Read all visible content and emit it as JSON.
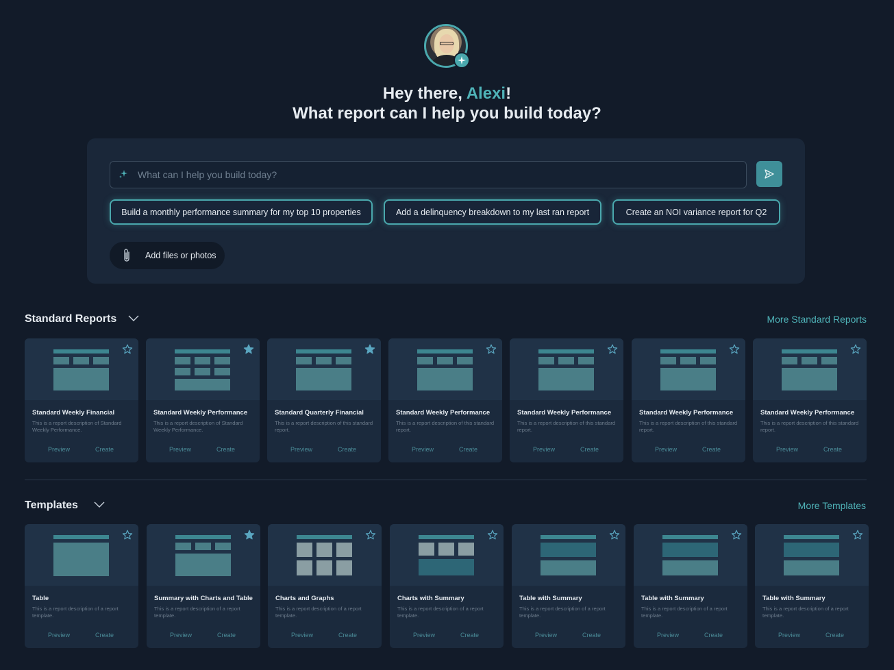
{
  "hero": {
    "greeting_prefix": "Hey there, ",
    "user_name": "Alexi",
    "greeting_suffix": "!",
    "question": "What report can I help you build today?"
  },
  "prompt": {
    "placeholder": "What can I help you build today?",
    "suggestions": [
      "Build a monthly performance summary for my top 10 properties",
      "Add a delinquency breakdown to my last ran report",
      "Create an NOI variance report for Q2"
    ],
    "attach_label": "Add files or photos"
  },
  "standard_reports": {
    "title": "Standard Reports",
    "more_link": "More Standard Reports",
    "cards": [
      {
        "title": "Standard Weekly Financial",
        "desc": "This is a report description of Standard Weekly Performance.",
        "starred": false,
        "layout": "table-3col"
      },
      {
        "title": "Standard Weekly Performance",
        "desc": "This is a report description of Standard Weekly Performance.",
        "starred": true,
        "layout": "table-6col"
      },
      {
        "title": "Standard Quarterly Financial",
        "desc": "This is a report description of this standard report.",
        "starred": true,
        "layout": "table-3col"
      },
      {
        "title": "Standard Weekly Performance",
        "desc": "This is a report description of this standard report.",
        "starred": false,
        "layout": "table-3col"
      },
      {
        "title": "Standard Weekly Performance",
        "desc": "This is a report description of this standard report.",
        "starred": false,
        "layout": "table-3col"
      },
      {
        "title": "Standard Weekly Performance",
        "desc": "This is a report description of this standard report.",
        "starred": false,
        "layout": "table-3col"
      },
      {
        "title": "Standard Weekly Performance",
        "desc": "This is a report description of this standard report.",
        "starred": false,
        "layout": "table-3col"
      }
    ],
    "preview_label": "Preview",
    "create_label": "Create"
  },
  "templates": {
    "title": "Templates",
    "more_link": "More Templates",
    "cards": [
      {
        "title": "Table",
        "desc": "This is a report description of a report template.",
        "starred": false,
        "layout": "table"
      },
      {
        "title": "Summary with Charts and Table",
        "desc": "This is a report description of a report template.",
        "starred": true,
        "layout": "table-3col"
      },
      {
        "title": "Charts and Graphs",
        "desc": "This is a report description of a report template.",
        "starred": false,
        "layout": "charts"
      },
      {
        "title": "Charts with Summary",
        "desc": "This is a report description of a report template.",
        "starred": false,
        "layout": "charts-summary"
      },
      {
        "title": "Table with Summary",
        "desc": "This is a report description of a report template.",
        "starred": false,
        "layout": "table-summary"
      },
      {
        "title": "Table with Summary",
        "desc": "This is a report description of a report template.",
        "starred": false,
        "layout": "table-summary"
      },
      {
        "title": "Table with Summary",
        "desc": "This is a report description of a report template.",
        "starred": false,
        "layout": "table-summary"
      }
    ],
    "preview_label": "Preview",
    "create_label": "Create"
  },
  "colors": {
    "background": "#121b29",
    "accent": "#4fb3b8",
    "panel": "#1a2739",
    "card": "#1b2a3d"
  }
}
